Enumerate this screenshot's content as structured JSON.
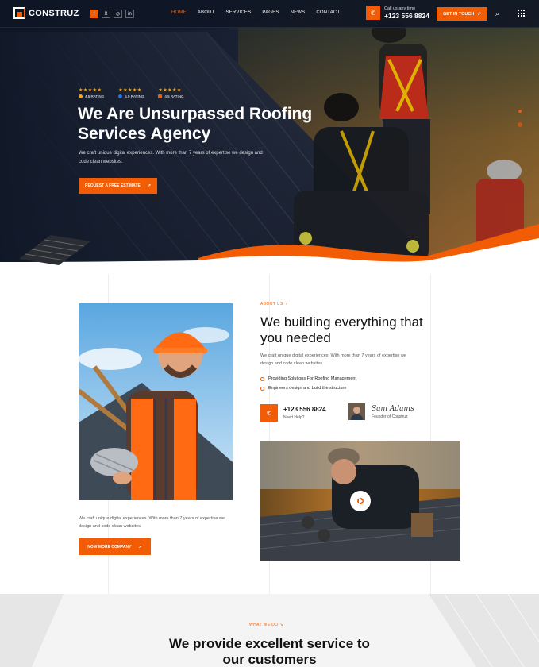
{
  "brand": {
    "name": "CONSTRUZ"
  },
  "socials": [
    {
      "label": "f",
      "icon": "facebook-icon"
    },
    {
      "label": "X",
      "icon": "x-icon"
    },
    {
      "label": "◎",
      "icon": "instagram-icon"
    },
    {
      "label": "in",
      "icon": "linkedin-icon"
    }
  ],
  "nav": [
    "HOME",
    "ABOUT",
    "SERVICES",
    "PAGES",
    "NEWS",
    "CONTACT"
  ],
  "header": {
    "call_small": "Call us any time",
    "call_number": "+123 556 8824",
    "cta_label": "GET IN TOUCH"
  },
  "hero": {
    "ratings": [
      {
        "stars": "★★★★★",
        "label": "4.5 RATING"
      },
      {
        "stars": "★★★★★",
        "label": "5.5 RATING"
      },
      {
        "stars": "★★★★★",
        "label": "4.5 RATING"
      }
    ],
    "title": "We Are Unsurpassed Roofing Services Agency",
    "description": "We craft unique digital experiences. With more than 7 years of expertise we design and code clean websites.",
    "button": "REQUEST A FREE ESTIMATE"
  },
  "about": {
    "tag": "ABOUT US",
    "title": "We building everything that you needed",
    "description": "We craft unique digital experiences. With more than 7 years of expertise we design and code clean websites.",
    "checks": [
      "Providing Solutions For Roofing Management",
      "Engineers design and build the structure"
    ],
    "phone": "+123 556 8824",
    "phone_label": "Need Help?",
    "signature": "Sam Adams",
    "founder_role": "Founder of Construz",
    "left_text": "We craft unique digital experiences. With more than 7 years of expertise we design and code clean websites.",
    "more_button": "NOW MORE COMPANY"
  },
  "services": {
    "tag": "WHAT WE DO",
    "title_line1": "We provide excellent service to",
    "title_line2": "our customers"
  },
  "colors": {
    "accent": "#f25c05",
    "dark": "#0f1727"
  }
}
